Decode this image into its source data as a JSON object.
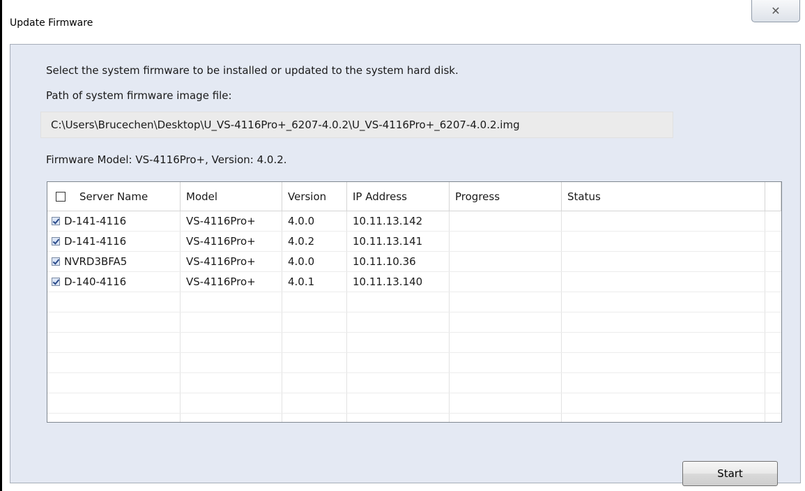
{
  "window": {
    "title": "Update Firmware",
    "close_icon": "close-x-icon"
  },
  "panel": {
    "description": "Select the system firmware to be installed or updated to the system hard disk.",
    "path_label": "Path of system firmware image file:",
    "path_value": "C:\\Users\\Brucechen\\Desktop\\U_VS-4116Pro+_6207-4.0.2\\U_VS-4116Pro+_6207-4.0.2.img",
    "model_info": "Firmware Model: VS-4116Pro+, Version: 4.0.2."
  },
  "table": {
    "headers": {
      "name": "Server Name",
      "model": "Model",
      "version": "Version",
      "ip": "IP Address",
      "progress": "Progress",
      "status": "Status"
    },
    "select_all_checked": false,
    "rows": [
      {
        "checked": true,
        "name": "D-141-4116",
        "model": "VS-4116Pro+",
        "version": "4.0.0",
        "ip": "10.11.13.142",
        "progress": "",
        "status": ""
      },
      {
        "checked": true,
        "name": "D-141-4116",
        "model": "VS-4116Pro+",
        "version": "4.0.2",
        "ip": "10.11.13.141",
        "progress": "",
        "status": ""
      },
      {
        "checked": true,
        "name": "NVRD3BFA5",
        "model": "VS-4116Pro+",
        "version": "4.0.0",
        "ip": "10.11.10.36",
        "progress": "",
        "status": ""
      },
      {
        "checked": true,
        "name": "D-140-4116",
        "model": "VS-4116Pro+",
        "version": "4.0.1",
        "ip": "10.11.13.140",
        "progress": "",
        "status": ""
      }
    ]
  },
  "buttons": {
    "start_label": "Start"
  }
}
